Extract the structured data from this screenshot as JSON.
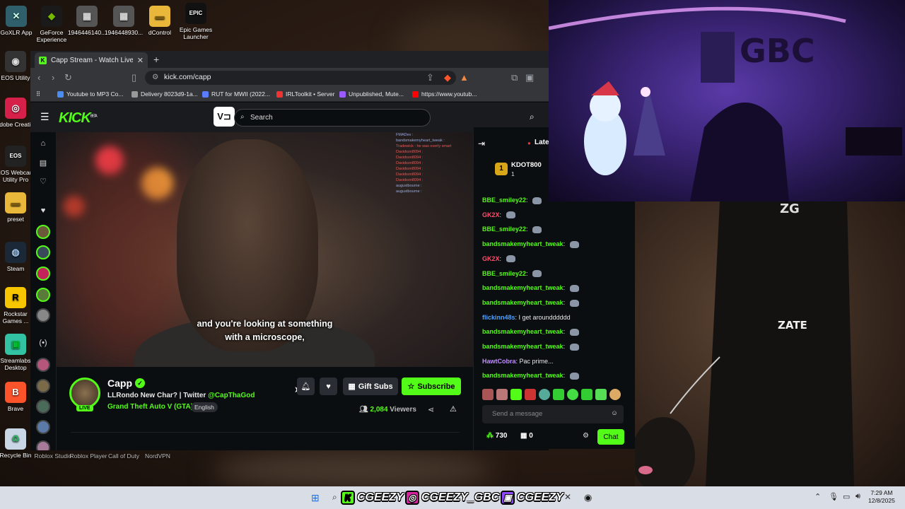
{
  "desktop": {
    "icons": [
      {
        "label": "GoXLR App",
        "glyph": "✕"
      },
      {
        "label": "GeForce Experience",
        "glyph": "◆"
      },
      {
        "label": "1946446140...",
        "glyph": "▦"
      },
      {
        "label": "1946448930...",
        "glyph": "▦"
      },
      {
        "label": "dControl",
        "glyph": "▬"
      },
      {
        "label": "Epic Games Launcher",
        "glyph": "EPIC"
      },
      {
        "label": "EOS Utility",
        "glyph": "◉"
      },
      {
        "label": "Adobe Creati...",
        "glyph": "◎"
      },
      {
        "label": "EOS Webcam Utility Pro",
        "glyph": "EOS"
      },
      {
        "label": "preset",
        "glyph": "▬"
      },
      {
        "label": "Steam",
        "glyph": "◍"
      },
      {
        "label": "Rockstar Games ...",
        "glyph": "R"
      },
      {
        "label": "Streamlabs Desktop",
        "glyph": "▣"
      },
      {
        "label": "Brave",
        "glyph": "B"
      },
      {
        "label": "Recycle Bin",
        "glyph": "♻"
      }
    ],
    "bottom_labels": [
      "Roblox Studio",
      "Roblox Player",
      "Call of Duty",
      "NordVPN"
    ]
  },
  "browser": {
    "tab_title": "Capp Stream - Watch Live on",
    "url": "kick.com/capp",
    "bookmarks": [
      "Youtube to MP3 Co...",
      "Delivery 8023d9-1a...",
      "RUT for MWII (2022...",
      "IRLToolkit • Server",
      "Unpublished, Mute...",
      "https://www.youtub..."
    ]
  },
  "kick": {
    "logo": "KICK",
    "logo_badge": "BETA",
    "search_placeholder": "Search",
    "video": {
      "subtitle_line1": "and you're looking at something",
      "subtitle_line2": "with a microscope,",
      "mini_chat": [
        "FMADev :",
        "bandsmakemyheart_tweak :",
        "Tradewick : he was overly smart",
        "Davidson8094 :",
        "Davidson8094 :",
        "Davidson8094 :",
        "Davidson8094 :",
        "Davidson8094 :",
        "Davidson8094 :",
        "augustbourne :",
        "augustbourne :"
      ]
    },
    "channel": {
      "name": "Capp",
      "live_label": "LIVE",
      "title_prefix": "LLRondo New Char? | Twitter ",
      "title_handle": "@CapThaGod",
      "category": "Grand Theft Auto V (GTA)",
      "language": "English",
      "viewer_count": "2,084",
      "viewer_label": "Viewers",
      "gift_label": "Gift Subs",
      "subscribe_label": "Subscribe"
    },
    "chat": {
      "latest_label": "Late",
      "top_gifter": "KDOT800",
      "top_gifter_count": "1",
      "messages": [
        {
          "user": "BBE_smiley22",
          "text": "",
          "color": "#53fc18"
        },
        {
          "user": "GK2X",
          "text": "",
          "color": "#ff4d6d"
        },
        {
          "user": "BBE_smiley22",
          "text": "",
          "color": "#53fc18"
        },
        {
          "user": "bandsmakemyheart_tweak",
          "text": "",
          "color": "#53fc18"
        },
        {
          "user": "GK2X",
          "text": "",
          "color": "#ff4d6d"
        },
        {
          "user": "BBE_smiley22",
          "text": "",
          "color": "#53fc18"
        },
        {
          "user": "bandsmakemyheart_tweak",
          "text": "",
          "color": "#53fc18"
        },
        {
          "user": "bandsmakemyheart_tweak",
          "text": "",
          "color": "#53fc18"
        },
        {
          "user": "flickinn48s",
          "text": "I get aroundddddd",
          "color": "#4ea1ff"
        },
        {
          "user": "bandsmakemyheart_tweak",
          "text": "",
          "color": "#53fc18"
        },
        {
          "user": "bandsmakemyheart_tweak",
          "text": "",
          "color": "#53fc18"
        },
        {
          "user": "HawtCobra",
          "text": "Pac prime...",
          "color": "#c08cff"
        },
        {
          "user": "bandsmakemyheart_tweak",
          "text": "",
          "color": "#53fc18"
        }
      ],
      "input_placeholder": "Send a message",
      "points": "730",
      "gifts": "0",
      "chat_button": "Chat"
    }
  },
  "webcam": {
    "wall_text": "GBC"
  },
  "side_photo": {
    "logo_text": "ZG",
    "belt_text": "ZATE"
  },
  "taskbar": {
    "brand1": "CGEEZY",
    "brand2": "CGEEZY_GBC",
    "brand3": "CGEEZY",
    "time": "7:29 AM",
    "date": "12/8/2025"
  },
  "colors": {
    "kick_green": "#53fc18",
    "kick_bg": "#0b0e10",
    "browser_chrome": "#35363a"
  }
}
